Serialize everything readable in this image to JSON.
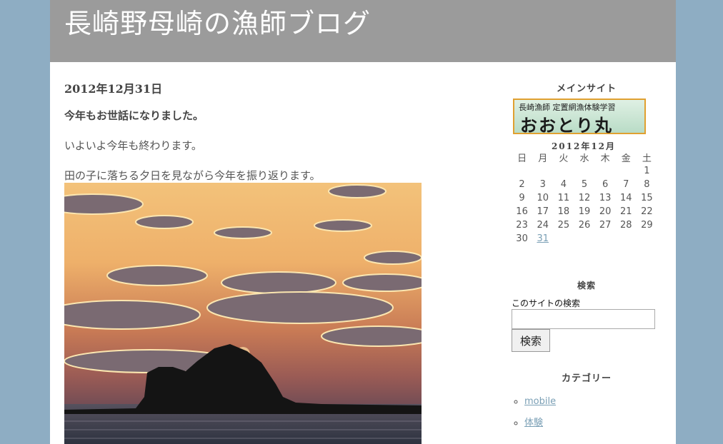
{
  "site": {
    "title": "長崎野母崎の漁師ブログ"
  },
  "post": {
    "date": "2012年12月31日",
    "title": "今年もお世話になりました。",
    "paragraphs": [
      "いよいよ今年も終わります。",
      "田の子に落ちる夕日を見ながら今年を振り返ります。"
    ]
  },
  "sidebar": {
    "main_site_heading": "メインサイト",
    "banner": {
      "top_text": "長崎漁師  定置網漁体験学習",
      "main_text": "おおとり丸"
    },
    "calendar": {
      "caption": "2012年12月",
      "weekdays": [
        "日",
        "月",
        "火",
        "水",
        "木",
        "金",
        "土"
      ],
      "weeks": [
        [
          "",
          "",
          "",
          "",
          "",
          "",
          "1"
        ],
        [
          "2",
          "3",
          "4",
          "5",
          "6",
          "7",
          "8"
        ],
        [
          "9",
          "10",
          "11",
          "12",
          "13",
          "14",
          "15"
        ],
        [
          "16",
          "17",
          "18",
          "19",
          "20",
          "21",
          "22"
        ],
        [
          "23",
          "24",
          "25",
          "26",
          "27",
          "28",
          "29"
        ],
        [
          "30",
          "31",
          "",
          "",
          "",
          "",
          ""
        ]
      ],
      "linked_day": "31"
    },
    "search": {
      "heading": "検索",
      "label": "このサイトの検索",
      "value": "",
      "button": "検索"
    },
    "categories": {
      "heading": "カテゴリー",
      "items": [
        "mobile",
        "体験"
      ]
    }
  },
  "colors": {
    "header_bg": "#9b9b9b",
    "page_bg": "#8eadc3",
    "link": "#7a9fb5",
    "banner_border": "#e0a030"
  }
}
